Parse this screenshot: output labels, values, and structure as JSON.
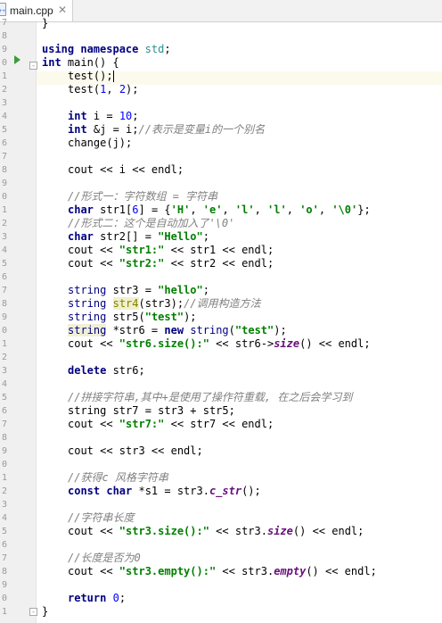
{
  "tab": {
    "file_name": "main.cpp",
    "close_glyph": "✕",
    "icon": "cpp-file-icon",
    "icon_text": "++"
  },
  "editor": {
    "top_partial_line": "}",
    "line_numbers": [
      "7",
      "8",
      "9",
      "0",
      "1",
      "2",
      "3",
      "4",
      "5",
      "6",
      "7",
      "8",
      "9",
      "0",
      "1",
      "2",
      "3",
      "4",
      "5",
      "6",
      "7",
      "8",
      "9",
      "0",
      "1",
      "2",
      "3",
      "4",
      "5",
      "6",
      "7",
      "8",
      "9",
      "0",
      "1",
      "2",
      "3",
      "4",
      "5",
      "6",
      "7",
      "8",
      "9",
      "0",
      "1"
    ],
    "code": {
      "l1_kw1": "using",
      "l1_kw2": "namespace",
      "l1_ns": "std",
      "l1_end": ";",
      "l2_kw": "int",
      "l2_rest": " main() {",
      "l3": "test();",
      "l4_a": "test(",
      "l4_n1": "1",
      "l4_b": ", ",
      "l4_n2": "2",
      "l4_c": ");",
      "l6_kw": "int",
      "l6_a": " i = ",
      "l6_n": "10",
      "l6_b": ";",
      "l7_kw": "int",
      "l7_a": " &j = i;",
      "l7_cm": "//表示是变量i的一个别名",
      "l8": "change(j);",
      "l10": "cout << i << endl;",
      "l12_cm": "//形式一：字符数组 = 字符串",
      "l13_kw": "char",
      "l13_a": " str1[",
      "l13_n": "6",
      "l13_b": "] = {",
      "l13_s1": "'H'",
      "l13_s2": "'e'",
      "l13_s3": "'l'",
      "l13_s4": "'l'",
      "l13_s5": "'o'",
      "l13_s6": "'\\0'",
      "l13_sep": ", ",
      "l13_c": "};",
      "l14_cm": "//形式二：这个是自动加入了'\\0'",
      "l15_kw": "char",
      "l15_a": " str2[] = ",
      "l15_s": "\"Hello\"",
      "l15_b": ";",
      "l16_a": "cout << ",
      "l16_s": "\"str1:\"",
      "l16_b": " << str1 << endl;",
      "l17_a": "cout << ",
      "l17_s": "\"str2:\"",
      "l17_b": " << str2 << endl;",
      "l19_ty": "string",
      "l19_a": " str3 = ",
      "l19_s": "\"hello\"",
      "l19_b": ";",
      "l20_ty": "string",
      "l20_a": " ",
      "l20_fd": "str4",
      "l20_b": "(str3);",
      "l20_cm": "//调用构造方法",
      "l21_ty": "string",
      "l21_a": " str5(",
      "l21_s": "\"test\"",
      "l21_b": ");",
      "l22_ty": "string",
      "l22_a": " *str6 = ",
      "l22_kw": "new",
      "l22_b": " ",
      "l22_ty2": "string",
      "l22_c": "(",
      "l22_s": "\"test\"",
      "l22_d": ");",
      "l23_a": "cout << ",
      "l23_s": "\"str6.size():\"",
      "l23_b": " << str6->",
      "l23_fn": "size",
      "l23_c": "() << endl;",
      "l25_kw": "delete",
      "l25_a": " str6;",
      "l27_cm": "//拼接字符串,其中+是使用了操作符重载, 在之后会学习到",
      "l28": "string str7 = str3 + str5;",
      "l29_a": "cout << ",
      "l29_s": "\"str7:\"",
      "l29_b": " << str7 << endl;",
      "l31": "cout << str3 << endl;",
      "l33_cm": "//获得c 风格字符串",
      "l34_kw": "const char",
      "l34_a": " *s1 = str3.",
      "l34_fn": "c_str",
      "l34_b": "();",
      "l36_cm": "//字符串长度",
      "l37_a": "cout << ",
      "l37_s": "\"str3.size():\"",
      "l37_b": " << str3.",
      "l37_fn": "size",
      "l37_c": "() << endl;",
      "l39_cm": "//长度是否为0",
      "l40_a": "cout << ",
      "l40_s": "\"str3.empty():\"",
      "l40_b": " << str3.",
      "l40_fn": "empty",
      "l40_c": "() << endl;",
      "l42_kw": "return",
      "l42_a": " ",
      "l42_n": "0",
      "l42_b": ";",
      "l43": "}"
    }
  },
  "colors": {
    "keyword": "#000080",
    "string": "#008000",
    "number": "#0000ff",
    "comment": "#808080",
    "current_line": "#fcfaed",
    "run_icon": "#3c9c3c"
  }
}
